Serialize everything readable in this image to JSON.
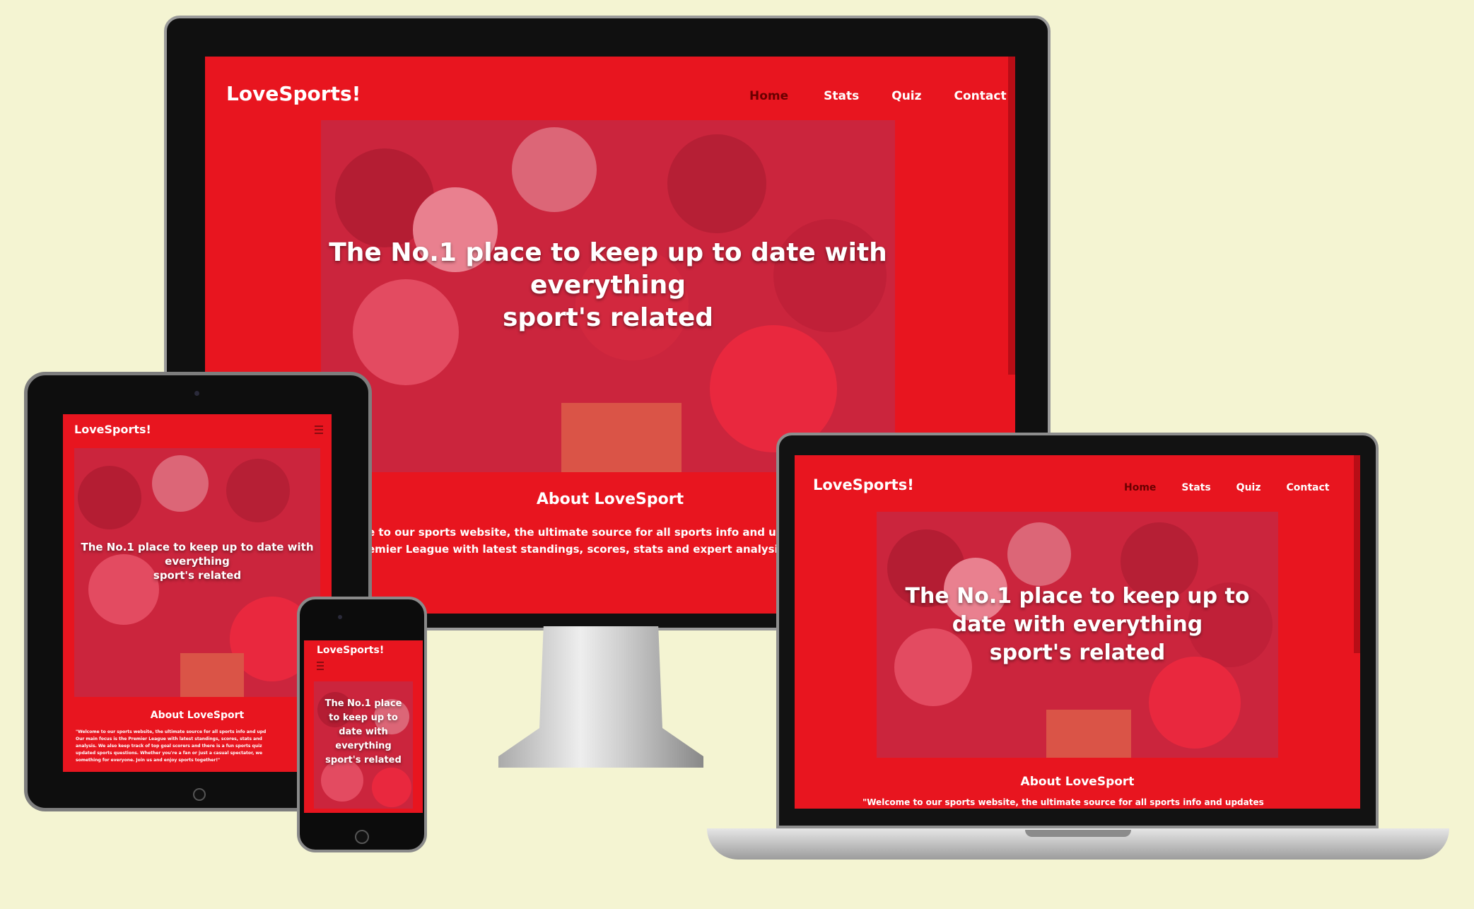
{
  "site": {
    "logo": "LoveSports!",
    "nav": [
      "Home",
      "Stats",
      "Quiz",
      "Contact"
    ],
    "active_nav": "Home",
    "hero_line1": "The No.1 place to keep up to date with",
    "hero_line2": "everything",
    "hero_line3": "sport's related",
    "laptop_hero_line1": "The No.1 place to keep up to",
    "laptop_hero_line2": "date with everything",
    "laptop_hero_line3": "sport's related",
    "tablet_hero_line1": "The No.1 place to keep up to date with",
    "tablet_hero_line2": "everything",
    "tablet_hero_line3": "sport's related",
    "phone_hero_lines": [
      "The No.1 place",
      "to keep up to",
      "date with",
      "everything",
      "sport's related"
    ],
    "about_title": "About LoveSport",
    "monitor_about_line1": "e to our sports website, the ultimate source for all sports info and updat",
    "monitor_about_line2": "emier League with latest standings, scores, stats and expert analysis. W",
    "laptop_about_line1": "\"Welcome to our sports website, the ultimate source for all sports info and updates",
    "tablet_about_lines": [
      "\"Welcome to our sports website, the ultimate source for all sports info and upd",
      "Our main focus is the Premier League with latest standings, scores, stats and",
      "analysis. We also keep track of top goal scorers and there is a fun sports quiz",
      "updated sports questions. Whether you're a fan or just a casual spectator, we",
      "something for everyone. Join us and enjoy sports together!\""
    ]
  },
  "colors": {
    "brand_red": "#e8151f",
    "active_nav": "#6a0000",
    "background": "#f4f4d2"
  }
}
